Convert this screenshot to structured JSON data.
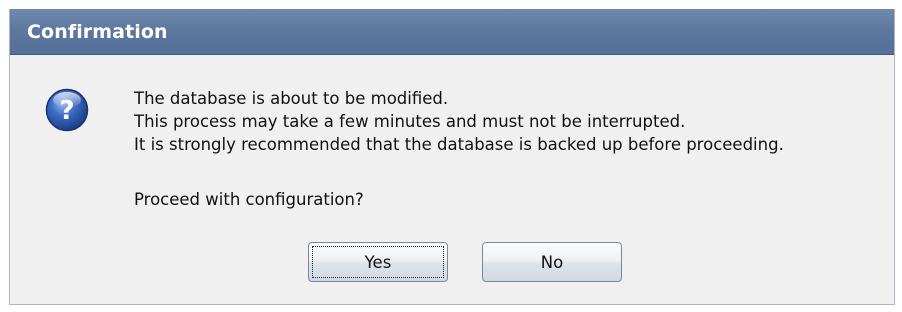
{
  "dialog": {
    "title": "Confirmation",
    "icon": "question-icon",
    "message_lines": [
      "The database is about to be modified.",
      "This process may take a few minutes and must not be interrupted.",
      "It is strongly recommended that the database is backed up before proceeding."
    ],
    "prompt": "Proceed with configuration?",
    "buttons": {
      "yes_label": "Yes",
      "no_label": "No"
    },
    "focused_button": "Yes"
  },
  "colors": {
    "titlebar": "#5d769d",
    "title_text": "#ffffff",
    "dialog_background": "#f0f0f0",
    "icon_blue": "#2f5fb0"
  }
}
